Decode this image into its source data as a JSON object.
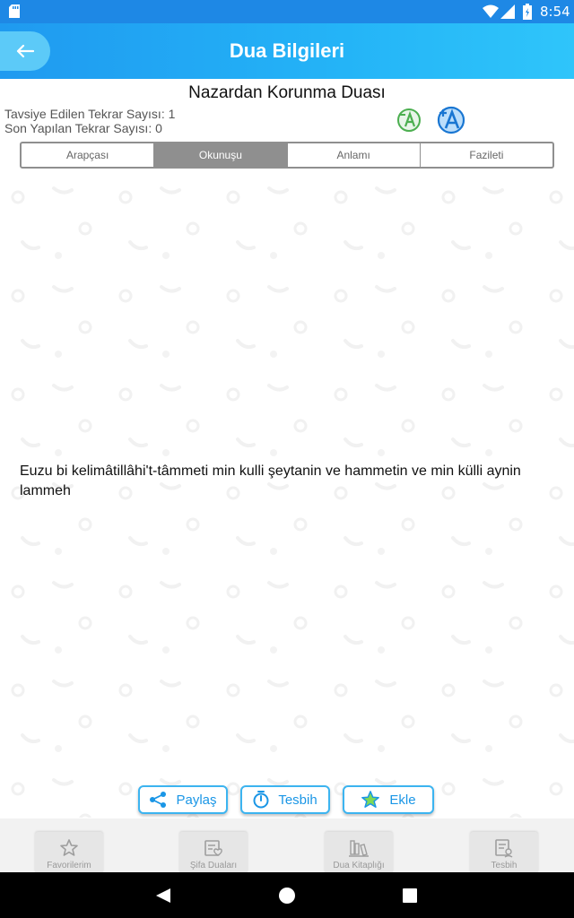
{
  "status_bar": {
    "time": "8:54"
  },
  "app_bar": {
    "title": "Dua Bilgileri"
  },
  "prayer": {
    "title": "Nazardan Korunma Duası",
    "recommended_count_label": "Tavsiye Edilen Tekrar Sayısı: 1",
    "done_count_label": "Son Yapılan Tekrar Sayısı: 0"
  },
  "tabs": [
    {
      "label": "Arapçası",
      "active": false
    },
    {
      "label": "Okunuşu",
      "active": true
    },
    {
      "label": "Anlamı",
      "active": false
    },
    {
      "label": "Fazileti",
      "active": false
    }
  ],
  "reading_text": "Euzu bi kelimâtillâhi't-tâmmeti min kulli şeytanin ve hammetin ve min külli aynin lammeh",
  "actions": {
    "share": "Paylaş",
    "tesbih": "Tesbih",
    "add": "Ekle"
  },
  "bottom_nav": [
    {
      "label": "Favorilerim",
      "icon": "star-icon"
    },
    {
      "label": "Şifa Duaları",
      "icon": "heart-book-icon"
    },
    {
      "label": "Dua Kitaplığı",
      "icon": "bookshelf-icon"
    },
    {
      "label": "Tesbih",
      "icon": "tesbih-book-icon"
    }
  ],
  "colors": {
    "accent": "#1f9af0",
    "status_bar": "#1e88e5",
    "tab_active": "#8f8f8f",
    "font_decrease": "#4caf50",
    "font_increase": "#1976d2"
  }
}
